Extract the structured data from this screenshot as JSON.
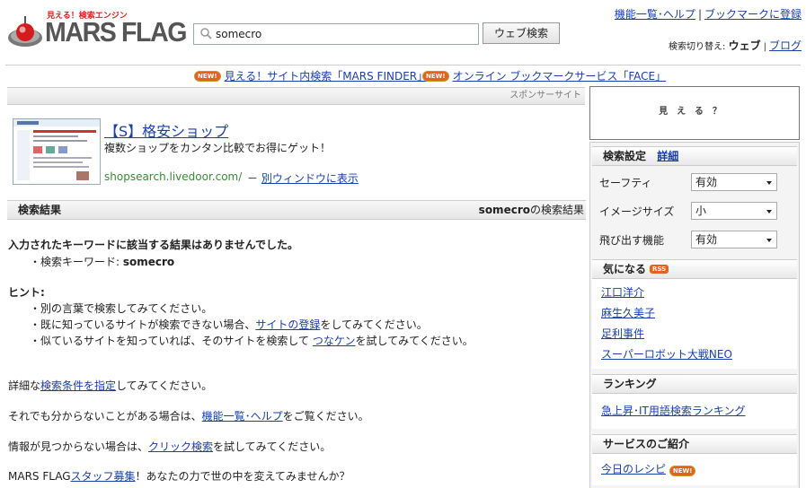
{
  "header": {
    "logo_tagline": "見える！検索エンジン",
    "logo_text": "MARS FLAG",
    "search_value": "somecro",
    "search_button": "ウェブ検索",
    "link_features": "機能一覧･ヘルプ",
    "link_bookmark": "ブックマークに登録",
    "switch_label": "検索切り替え:",
    "switch_current": "ウェブ",
    "switch_blog": "ブログ"
  },
  "promos": [
    {
      "badge": "NEW!",
      "text": "見える！サイト内検索「MARS FINDER」"
    },
    {
      "badge": "NEW!",
      "text": "オンライン ブックマークサービス「FACE」"
    }
  ],
  "sponsor": {
    "label": "スポンサーサイト",
    "ad_title": "【S】格安ショップ",
    "ad_desc": "複数ショップをカンタン比較でお得にゲット！",
    "ad_url": "shopsearch.livedoor.com/",
    "ad_dash": "－",
    "ad_newwin": "別ウィンドウに表示"
  },
  "results": {
    "title": "検索結果",
    "query": "somecro",
    "query_suffix": "の検索結果",
    "no_result": "入力されたキーワードに該当する結果はありませんでした。",
    "kw_label": "・検索キーワード: ",
    "kw_value": "somecro",
    "hint_title": "ヒント:",
    "hint1": "・別の言葉で検索してみてください。",
    "hint2_pre": "・既に知っているサイトが検索できない場合、",
    "hint2_link": "サイトの登録",
    "hint2_post": "をしてみてください。",
    "hint3_pre": "・似ているサイトを知っていれば、そのサイトを検索して ",
    "hint3_link": "つなケン",
    "hint3_post": "を試してみてください。",
    "p1_pre": "詳細な",
    "p1_link": "検索条件を指定",
    "p1_post": "してみてください。",
    "p2_pre": "それでも分からないことがある場合は、",
    "p2_link": "機能一覧･ヘルプ",
    "p2_post": "をご覧ください。",
    "p3_pre": "情報が見つからない場合は、",
    "p3_link": "クリック検索",
    "p3_post": "を試してみてください。",
    "p4_pre": "MARS FLAG",
    "p4_link": "スタッフ募集",
    "p4_post": "！あなたの力で世の中を変えてみませんか？"
  },
  "sidebar": {
    "ad_text": "見える？",
    "settings_title": "検索設定",
    "settings_detail": "詳細",
    "safety_label": "セーフティ",
    "safety_value": "有効",
    "imgsize_label": "イメージサイズ",
    "imgsize_value": "小",
    "popout_label": "飛び出す機能",
    "popout_value": "有効",
    "trend_title": "気になる",
    "rss_badge": "RSS",
    "trend_items": [
      "江口洋介",
      "麻生久美子",
      "足利事件",
      "スーパーロボット大戦NEO"
    ],
    "ranking_title": "ランキング",
    "ranking_link": "急上昇･IT用語検索ランキング",
    "services_title": "サービスのご紹介",
    "service1": "今日のレシピ",
    "service1_badge": "NEW!"
  }
}
